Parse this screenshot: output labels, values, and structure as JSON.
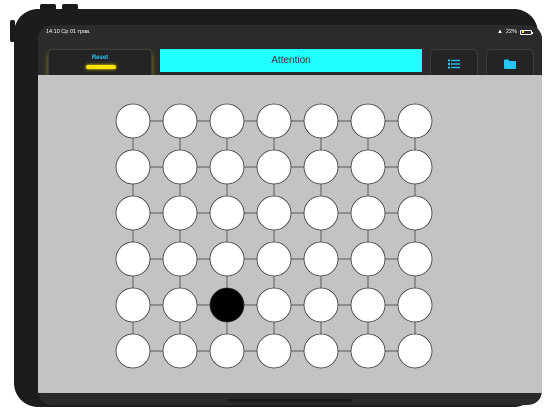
{
  "status_bar": {
    "time": "14:10",
    "date": "Ср 01 трав.",
    "battery": "22%"
  },
  "toolbar": {
    "reset_label": "Reset",
    "title": "Attention",
    "list_icon": "list-icon",
    "folder_icon": "folder-icon"
  },
  "grid": {
    "rows": 6,
    "cols": 7,
    "filled": [
      [
        4,
        2
      ]
    ],
    "colors": {
      "empty": "#ffffff",
      "filled": "#000000",
      "stroke": "#333333",
      "background": "#c3c3c3"
    }
  }
}
